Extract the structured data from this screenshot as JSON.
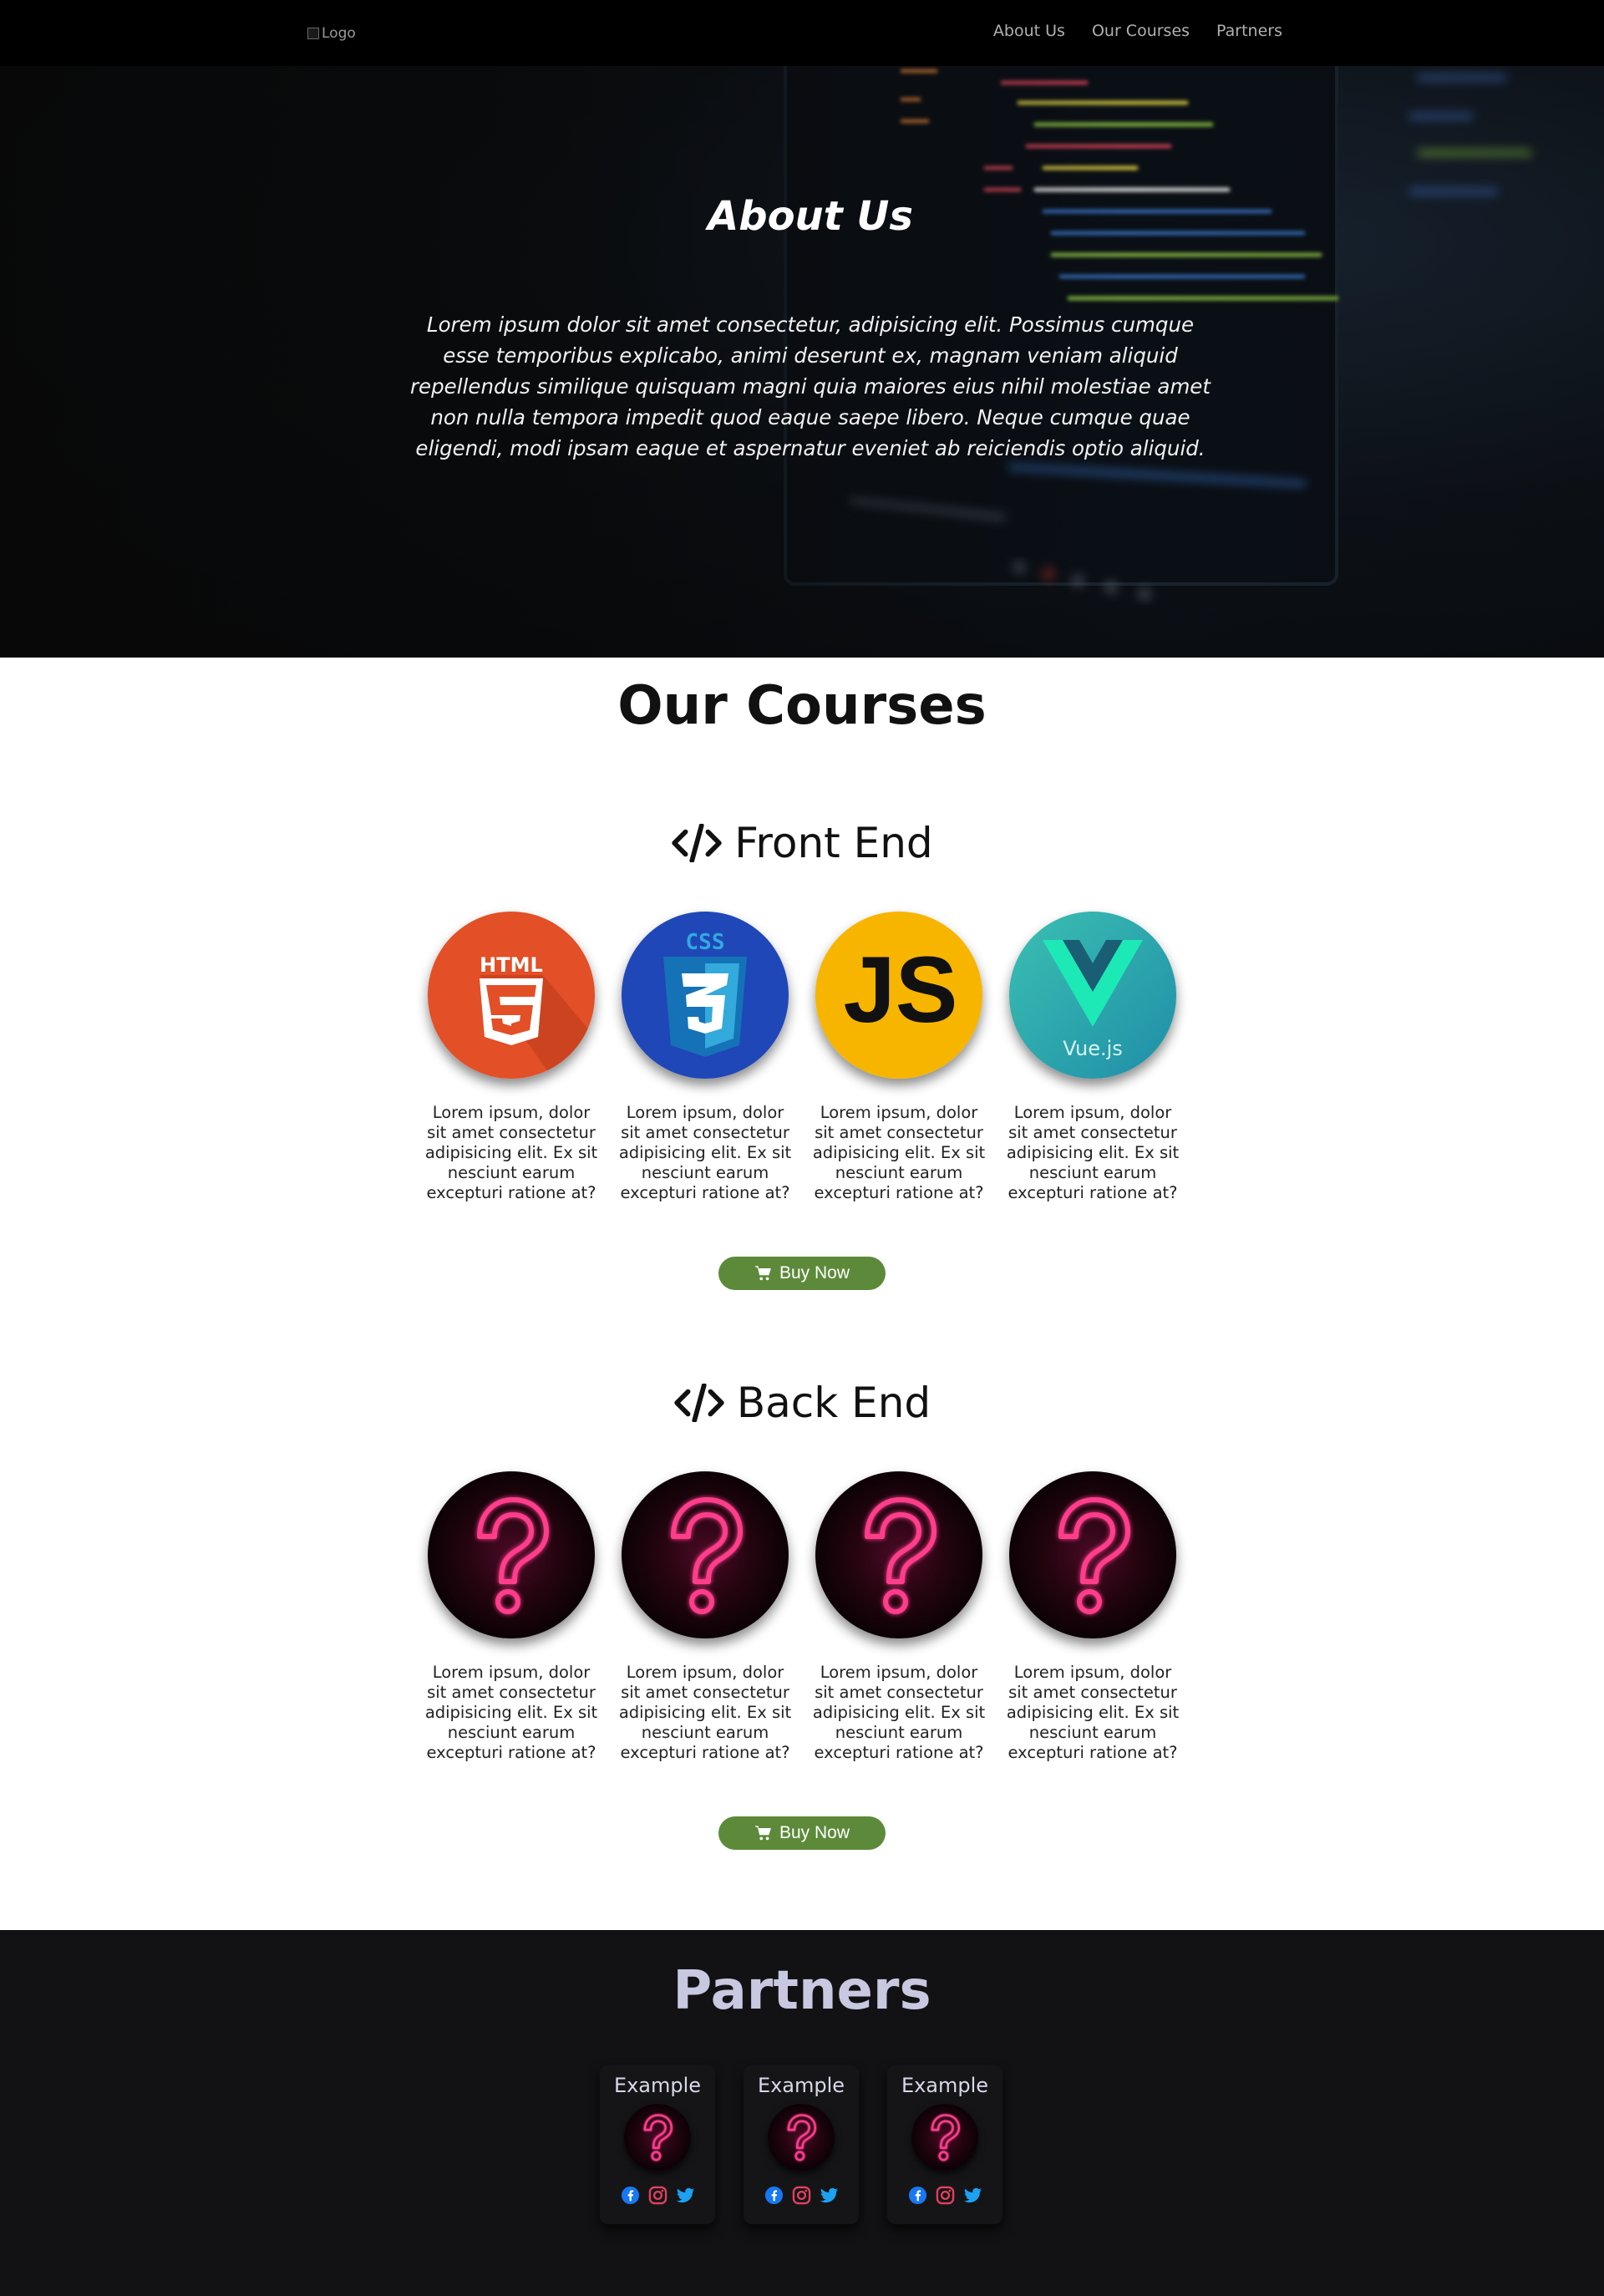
{
  "nav": {
    "logo_alt": "Logo",
    "links": [
      "About Us",
      "Our Courses",
      "Partners"
    ]
  },
  "hero": {
    "title": "About Us",
    "text": "Lorem ipsum dolor sit amet consectetur, adipisicing elit. Possimus cumque esse temporibus explicabo, animi deserunt ex, magnam veniam aliquid repellendus similique quisquam magni quia maiores eius nihil molestiae amet non nulla tempora impedit quod eaque saepe libero. Neque cumque quae eligendi, modi ipsam eaque et aspernatur eveniet ab reiciendis optio aliquid."
  },
  "courses": {
    "title": "Our Courses",
    "front_end": {
      "heading": "Front End",
      "items": [
        {
          "icon": "html5-icon",
          "logo_text": "HTML",
          "text": "Lorem ipsum, dolor sit amet consectetur adipisicing elit. Ex sit nesciunt earum excepturi ratione at?"
        },
        {
          "icon": "css3-icon",
          "logo_text": "CSS",
          "text": "Lorem ipsum, dolor sit amet consectetur adipisicing elit. Ex sit nesciunt earum excepturi ratione at?"
        },
        {
          "icon": "javascript-icon",
          "logo_text": "JS",
          "text": "Lorem ipsum, dolor sit amet consectetur adipisicing elit. Ex sit nesciunt earum excepturi ratione at?"
        },
        {
          "icon": "vuejs-icon",
          "logo_text": "Vue.js",
          "text": "Lorem ipsum, dolor sit amet consectetur adipisicing elit. Ex sit nesciunt earum excepturi ratione at?"
        }
      ],
      "buy_label": "Buy Now"
    },
    "back_end": {
      "heading": "Back End",
      "items": [
        {
          "icon": "question-mark-icon",
          "text": "Lorem ipsum, dolor sit amet consectetur adipisicing elit. Ex sit nesciunt earum excepturi ratione at?"
        },
        {
          "icon": "question-mark-icon",
          "text": "Lorem ipsum, dolor sit amet consectetur adipisicing elit. Ex sit nesciunt earum excepturi ratione at?"
        },
        {
          "icon": "question-mark-icon",
          "text": "Lorem ipsum, dolor sit amet consectetur adipisicing elit. Ex sit nesciunt earum excepturi ratione at?"
        },
        {
          "icon": "question-mark-icon",
          "text": "Lorem ipsum, dolor sit amet consectetur adipisicing elit. Ex sit nesciunt earum excepturi ratione at?"
        }
      ],
      "buy_label": "Buy Now"
    }
  },
  "partners": {
    "title": "Partners",
    "items": [
      {
        "name": "Example",
        "social": [
          "facebook-icon",
          "instagram-icon",
          "twitter-icon"
        ]
      },
      {
        "name": "Example",
        "social": [
          "facebook-icon",
          "instagram-icon",
          "twitter-icon"
        ]
      },
      {
        "name": "Example",
        "social": [
          "facebook-icon",
          "instagram-icon",
          "twitter-icon"
        ]
      }
    ]
  },
  "colors": {
    "nav_bg": "#000000",
    "buy_button": "#5c8a3a",
    "partners_bg": "#121214",
    "html5": "#e34f26",
    "css3": "#1f47b8",
    "javascript": "#f7b500",
    "vue": "#2aa8a8",
    "neon_pink": "#ff3d8b"
  }
}
